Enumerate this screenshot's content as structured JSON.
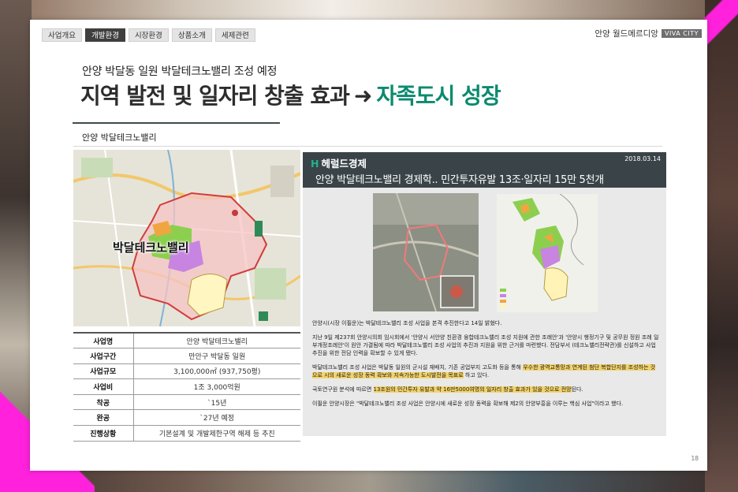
{
  "tabs": [
    {
      "label": "사업개요",
      "active": false
    },
    {
      "label": "개발환경",
      "active": true
    },
    {
      "label": "시장환경",
      "active": false
    },
    {
      "label": "상품소개",
      "active": false
    },
    {
      "label": "세제관련",
      "active": false
    }
  ],
  "brand": {
    "name": "안양 월드메르디앙",
    "badge": "VIVA CITY"
  },
  "subtitle": "안양 박달동 일원 박달테크노밸리 조성 예정",
  "headline": {
    "main": "지역 발전 및 일자리 창출 효과",
    "arrow": "➜",
    "highlight": "자족도시 성장"
  },
  "section_title": "안양 박달테크노밸리",
  "map_label": "박달테크노밸리",
  "info_table": [
    {
      "key": "사업명",
      "value": "안양 박달테크노밸리"
    },
    {
      "key": "사업구간",
      "value": "만안구 박달동 일원"
    },
    {
      "key": "사업규모",
      "value": "3,100,000㎡ (937,750평)"
    },
    {
      "key": "사업비",
      "value": "1조 3,000억원"
    },
    {
      "key": "착공",
      "value": "`15년"
    },
    {
      "key": "완공",
      "value": "`27년 예정"
    },
    {
      "key": "진행상황",
      "value": "기본설계 및 개발제한구역 해제 등 추진"
    }
  ],
  "article": {
    "source": "헤럴드경제",
    "source_mark": "H",
    "date": "2018.03.14",
    "title": "안양 박달테크노밸리 경제학.. 민간투자유발 13조·일자리 15만 5천개",
    "p1": "안양시(시장 이필운)는 박달테크노밸리 조성 사업을 본격 추진한다고 14일 밝혔다.",
    "p2": "지난 9일 제237회 안양시의회 임시회에서 '안양시 서안양 친환경 융합테크노밸리 조성 지원에 관한 조례안'과 '안양시 행정기구 및 공무원 정원 조례 일부개정조례안'이 원안 가결됨에 따라 박달테크노밸리 조성 사업의 추진과 지원을 위한 근거를 마련했다. 전담부서 (테크노밸리전략관)를 신설하고 사업 추진을 위한 전담 인력을 확보할 수 있게 됐다.",
    "p3_a": "박달테크노밸리 조성 사업은 박달동 일원의 군시설 재배치, 기존 공업부지 고도화 등을 통해 ",
    "p3_hl": "우수한 광역교통망과 연계된 첨단 복합단지를 조성하는 것으로 시의 새로운 성장 동력 확보와 지속가능한 도시발전을 목표로",
    "p3_b": " 하고 있다.",
    "p4_a": "국토연구원 분석에 따르면 ",
    "p4_hl": "13조원의 민간투자 유발과 약 16만5000여명의 일자리 창출 효과가 있을 것으로 전망",
    "p4_b": "된다.",
    "p5": "이필운 안양시장은 \"박달테크노밸리 조성 사업은 안양시에 새로운 성장 동력을 확보해 제2의 안양부흥을 이루는 핵심 사업\"이라고 했다."
  },
  "page_number": "18",
  "colors": {
    "accent_green": "#0b8a6e",
    "magenta": "#ff21dc",
    "header_dark": "#3a4448",
    "highlight": "#f3d36a"
  }
}
